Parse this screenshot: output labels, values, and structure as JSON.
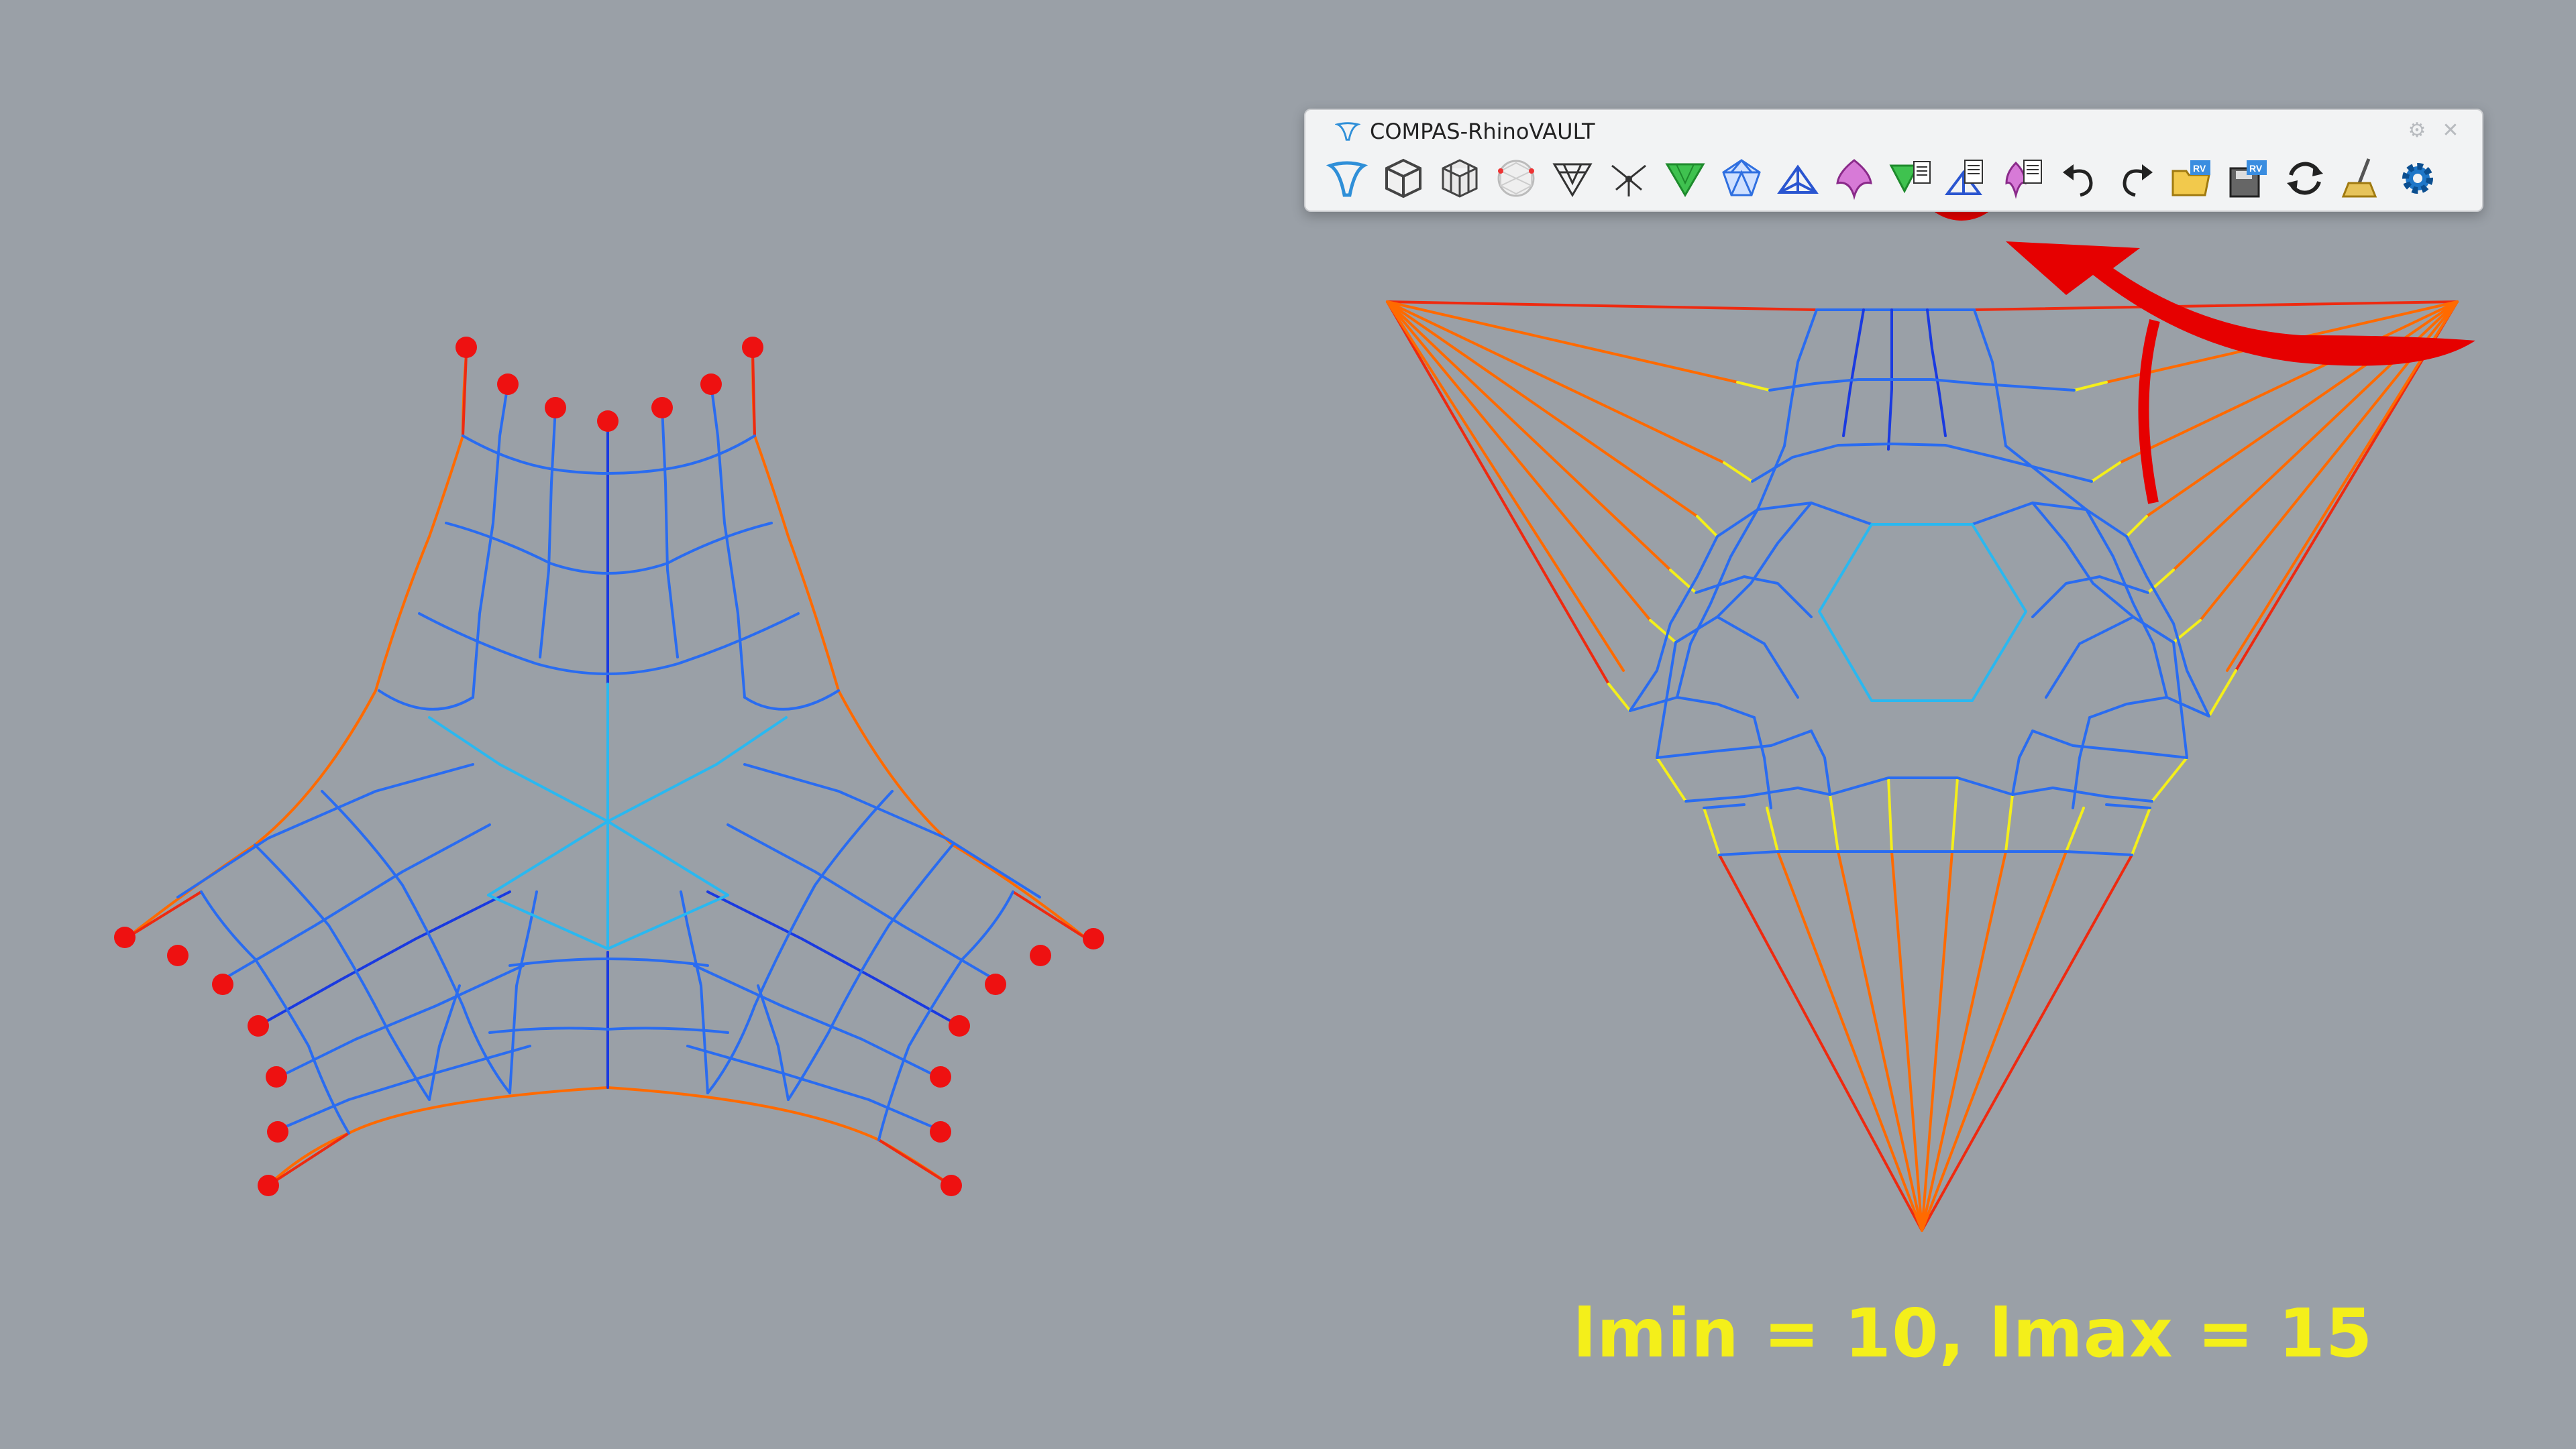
{
  "toolbar": {
    "title": "COMPAS-RhinoVAULT",
    "settings_icon": "gear-icon",
    "close_icon": "close-icon",
    "buttons": [
      {
        "name": "rv-init",
        "icon": "rhinovault-logo-icon",
        "color": "#2f8fd8"
      },
      {
        "name": "form-from-surface",
        "icon": "cube-icon",
        "color": "#555555"
      },
      {
        "name": "form-from-mesh",
        "icon": "mesh-cube-icon",
        "color": "#555555"
      },
      {
        "name": "form-from-triangulation",
        "icon": "triangulated-sphere-icon",
        "color": "#c9c9c9"
      },
      {
        "name": "form-modify",
        "icon": "form-triangle-icon",
        "color": "#333333"
      },
      {
        "name": "form-supports",
        "icon": "supports-icon",
        "color": "#333333"
      },
      {
        "name": "force-from-form",
        "icon": "green-force-icon",
        "color": "#28b43a"
      },
      {
        "name": "force-diagram",
        "icon": "diamond-mesh-icon",
        "color": "#2f6fe0"
      },
      {
        "name": "horizontal-equilibrium",
        "icon": "blue-equilibrium-icon",
        "color": "#2a55d0"
      },
      {
        "name": "vertical-equilibrium",
        "icon": "purple-vault-icon",
        "color": "#b04ab0"
      },
      {
        "name": "force-modify",
        "icon": "green-force-doc-icon",
        "color": "#28b43a"
      },
      {
        "name": "form-force-lengths",
        "icon": "form-doc-icon",
        "color": "#2a55d0",
        "highlighted": true
      },
      {
        "name": "thrust-diagram",
        "icon": "purple-doc-icon",
        "color": "#b04ab0"
      },
      {
        "name": "undo",
        "icon": "undo-icon",
        "color": "#222222"
      },
      {
        "name": "redo",
        "icon": "redo-icon",
        "color": "#222222"
      },
      {
        "name": "open-session",
        "icon": "open-folder-rv-icon",
        "color": "#e6b82a"
      },
      {
        "name": "save-session",
        "icon": "save-disk-rv-icon",
        "color": "#444444"
      },
      {
        "name": "redraw",
        "icon": "refresh-icon",
        "color": "#222222"
      },
      {
        "name": "clear",
        "icon": "broom-icon",
        "color": "#c8a23a"
      },
      {
        "name": "settings",
        "icon": "blue-gear-icon",
        "color": "#1f77c8"
      }
    ]
  },
  "annotation": {
    "highlight_color": "#e60000",
    "arrow_color": "#e60000"
  },
  "caption": "lmin = 10, lmax = 15",
  "colors": {
    "background": "#9aa0a7",
    "support_point": "#ee1111",
    "caption": "#f4ef1a"
  }
}
